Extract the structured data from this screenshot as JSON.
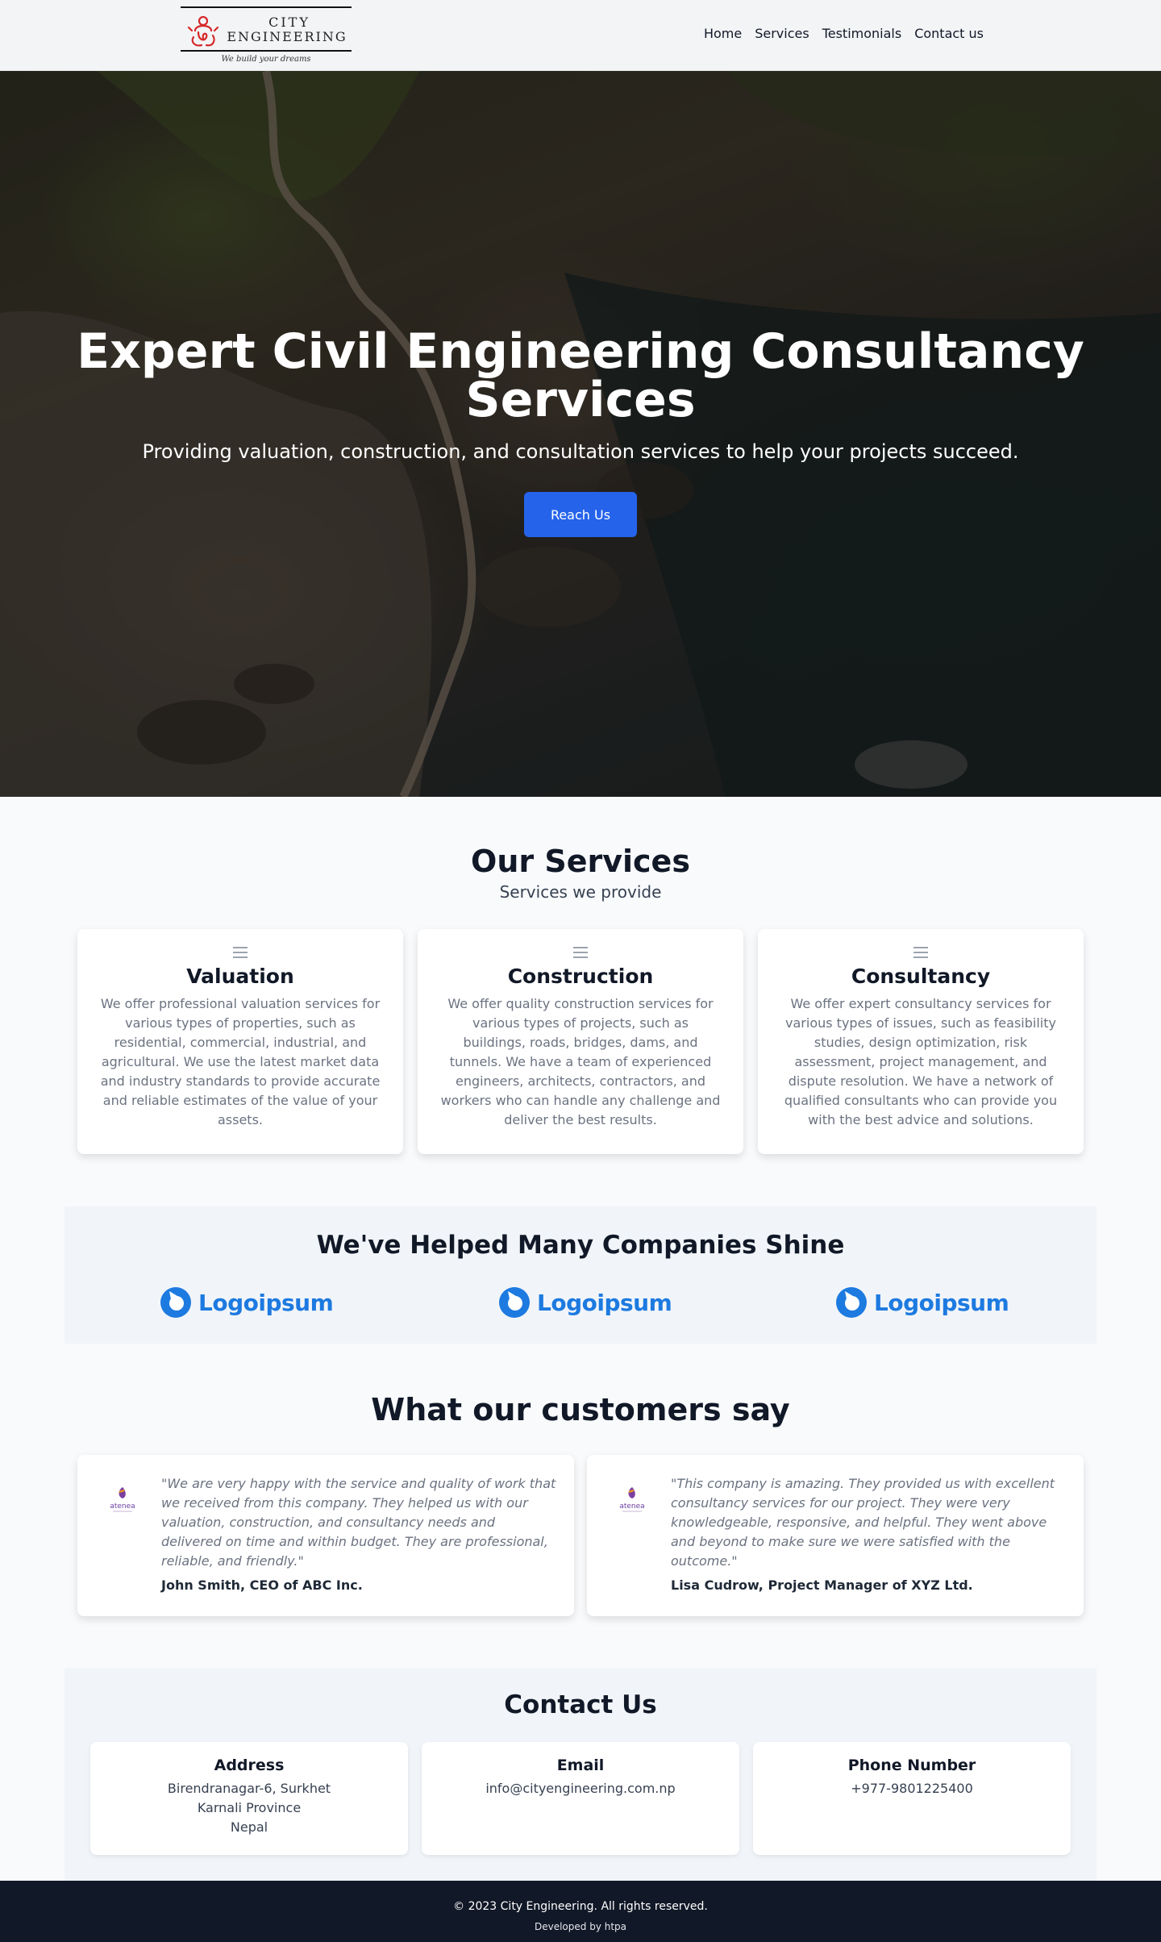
{
  "header": {
    "logo": {
      "line1": "CITY",
      "line2": "ENGINEERING",
      "tagline": "We build your dreams"
    },
    "nav": [
      "Home",
      "Services",
      "Testimonials",
      "Contact us"
    ]
  },
  "hero": {
    "title": "Expert Civil Engineering Consultancy Services",
    "subtitle": "Providing valuation, construction, and consultation services to help your projects succeed.",
    "cta_label": "Reach Us"
  },
  "services": {
    "title": "Our Services",
    "subtitle": "Services we provide",
    "items": [
      {
        "icon": "menu-icon",
        "title": "Valuation",
        "text": "We offer professional valuation services for various types of properties, such as residential, commercial, industrial, and agricultural. We use the latest market data and industry standards to provide accurate and reliable estimates of the value of your assets."
      },
      {
        "icon": "menu-icon",
        "title": "Construction",
        "text": "We offer quality construction services for various types of projects, such as buildings, roads, bridges, dams, and tunnels. We have a team of experienced engineers, architects, contractors, and workers who can handle any challenge and deliver the best results."
      },
      {
        "icon": "menu-icon",
        "title": "Consultancy",
        "text": "We offer expert consultancy services for various types of issues, such as feasibility studies, design optimization, risk assessment, project management, and dispute resolution. We have a network of qualified consultants who can provide you with the best advice and solutions."
      }
    ]
  },
  "companies": {
    "title": "We've Helped Many Companies Shine",
    "logos": [
      "Logoipsum",
      "Logoipsum",
      "Logoipsum"
    ],
    "brand_color": "#1d7ae0"
  },
  "testimonials": {
    "title": "What our customers say",
    "items": [
      {
        "avatar_text": "atenea",
        "quote": "\"We are very happy with the service and quality of work that we received from this company. They helped us with our valuation, construction, and consultancy needs and delivered on time and within budget. They are professional, reliable, and friendly.\"",
        "author": "John Smith, CEO of ABC Inc."
      },
      {
        "avatar_text": "atenea",
        "quote": "\"This company is amazing. They provided us with excellent consultancy services for our project. They were very knowledgeable, responsive, and helpful. They went above and beyond to make sure we were satisfied with the outcome.\"",
        "author": "Lisa Cudrow, Project Manager of XYZ Ltd."
      }
    ]
  },
  "contact": {
    "title": "Contact Us",
    "cards": [
      {
        "title": "Address",
        "lines": [
          "Birendranagar-6, Surkhet",
          "Karnali Province",
          "Nepal"
        ]
      },
      {
        "title": "Email",
        "lines": [
          "info@cityengineering.com.np"
        ]
      },
      {
        "title": "Phone Number",
        "lines": [
          "+977-9801225400"
        ]
      }
    ]
  },
  "footer": {
    "copyright": "© 2023 City Engineering. All rights reserved.",
    "developed_by": "Developed by htpa"
  },
  "colors": {
    "accent": "#2563eb",
    "footer_bg": "#111827",
    "logo_red": "#d62828"
  }
}
